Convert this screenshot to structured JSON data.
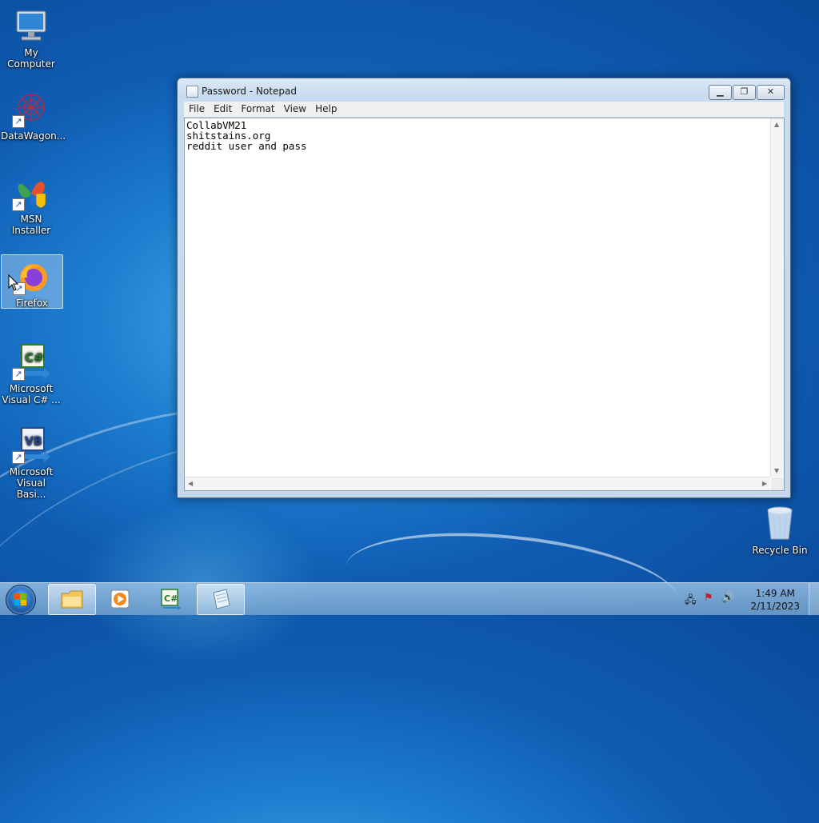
{
  "desktop": {
    "icons": [
      {
        "label": "My Computer"
      },
      {
        "label": "DataWagon..."
      },
      {
        "label": "MSN Installer"
      },
      {
        "label": "Firefox"
      },
      {
        "label": "Microsoft Visual C# ..."
      },
      {
        "label": "Microsoft Visual Basi..."
      }
    ],
    "recycle_bin": {
      "label": "Recycle Bin"
    }
  },
  "notepad": {
    "title": "Password - Notepad",
    "menu": [
      "File",
      "Edit",
      "Format",
      "View",
      "Help"
    ],
    "content": "CollabVM21\nshitstains.org\nreddit user and pass"
  },
  "taskbar": {
    "clock_time": "1:49 AM",
    "clock_date": "2/11/2023"
  },
  "colors": {
    "desktop_blue": "#1e7fd0",
    "taskbar": "#a9cbe8"
  }
}
